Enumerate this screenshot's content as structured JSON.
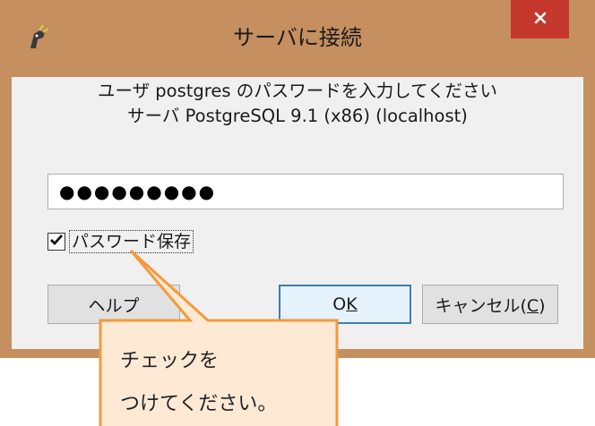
{
  "window": {
    "title": "サーバに接続",
    "close_glyph": "×"
  },
  "message": {
    "line1": "ユーザ postgres のパスワードを入力してください",
    "line2": "サーバ PostgreSQL 9.1 (x86) (localhost)"
  },
  "password_field": {
    "masked_value": "●●●●●●●●●"
  },
  "save_password": {
    "checked": true,
    "label": "パスワード保存"
  },
  "buttons": {
    "help": "ヘルプ",
    "ok_prefix": "O",
    "ok_mnemonic": "K",
    "cancel_prefix": "キャンセル(",
    "cancel_mnemonic": "C",
    "cancel_suffix": ")"
  },
  "callout": {
    "line1": "チェックを",
    "line2": "つけてください。"
  },
  "colors": {
    "title_bar": "#c58f5f",
    "close_button": "#c5382d",
    "client_bg": "#f0f0f0",
    "callout_fill": "#fde9d4",
    "callout_border": "#f29b3d"
  }
}
